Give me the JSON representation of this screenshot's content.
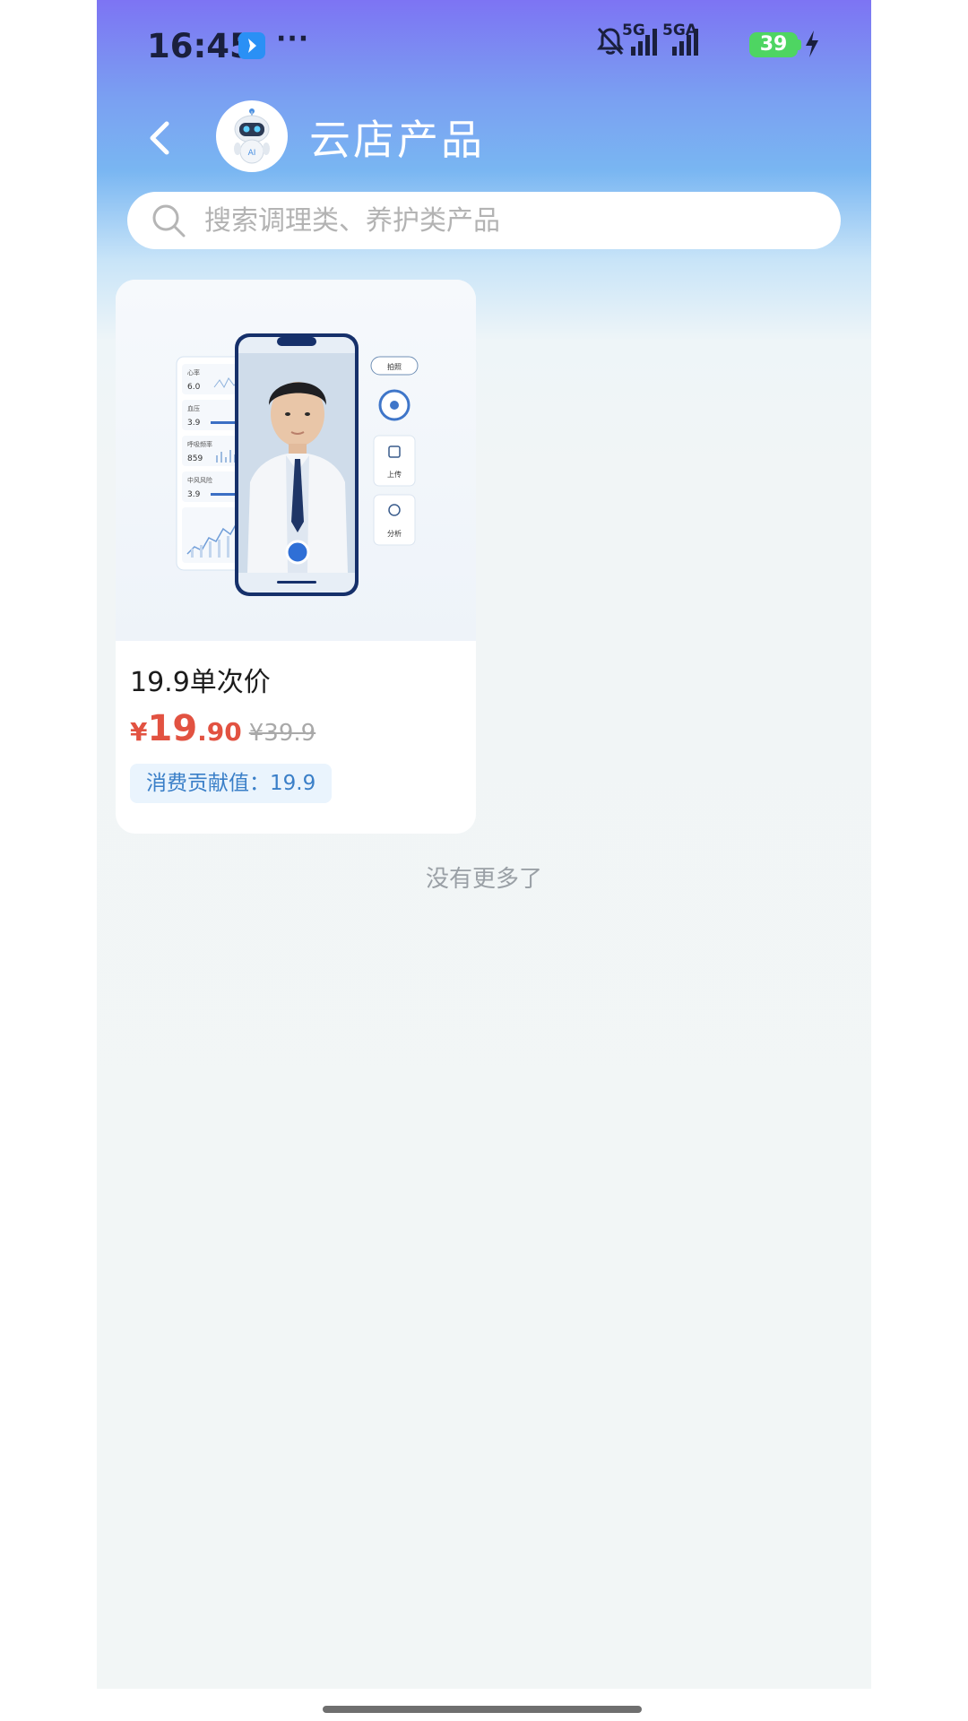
{
  "status_bar": {
    "time": "16:45",
    "more": "···",
    "network_1": "5G",
    "network_2": "5GA",
    "battery": "39",
    "icons": [
      "app-notification-icon",
      "mute-bell-icon",
      "signal-icon",
      "signal-icon",
      "charging-bolt-icon"
    ]
  },
  "header": {
    "title": "云店产品",
    "avatar_icon": "ai-robot-avatar",
    "back_icon": "chevron-left-icon"
  },
  "search": {
    "placeholder": "搜索调理类、养护类产品",
    "value": ""
  },
  "products": [
    {
      "name": "19.9单次价",
      "price_symbol": "¥",
      "price_int": "19",
      "price_dec": ".90",
      "original_price": "¥39.9",
      "contribution": "消费贡献值：19.9",
      "image_labels": {
        "capture": "拍照",
        "upload": "上传",
        "analyze": "分析",
        "metric_1": "心率",
        "metric_2": "血压",
        "metric_3": "呼吸频率",
        "metric_4": "中风风险",
        "val_1": "6.0",
        "val_2": "3.9",
        "val_3": "859",
        "val_4": "3.9"
      }
    }
  ],
  "list_footer": "没有更多了",
  "colors": {
    "accent_price": "#e25241",
    "badge_text": "#3a7fc8",
    "battery": "#4ed562",
    "header_gradient_top": "#7d74f3"
  }
}
